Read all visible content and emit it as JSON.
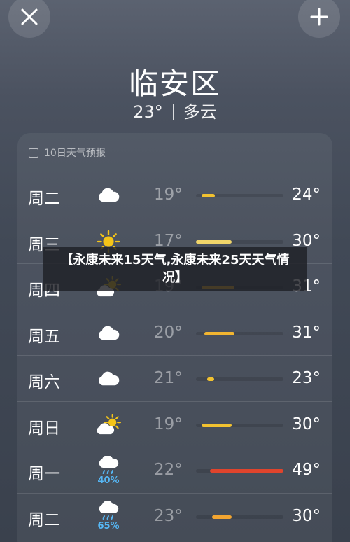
{
  "header": {
    "close_icon": "close-icon",
    "add_icon": "plus-icon",
    "city": "临安区",
    "temp": "23°",
    "condition": "多云"
  },
  "forecast": {
    "title": "10日天气预报",
    "range_min": 17,
    "range_max": 49,
    "days": [
      {
        "day": "周二",
        "icon": "cloud-icon",
        "precip": "",
        "low": "19°",
        "high": "24°",
        "low_val": 19,
        "high_val": 24,
        "color": "#f2c230"
      },
      {
        "day": "周三",
        "icon": "sun-icon",
        "precip": "",
        "low": "17°",
        "high": "30°",
        "low_val": 17,
        "high_val": 30,
        "color": "#f0d56a"
      },
      {
        "day": "周四",
        "icon": "partly-cloudy-icon",
        "precip": "",
        "low": "19°",
        "high": "31°",
        "low_val": 19,
        "high_val": 31,
        "color": "#f2b531"
      },
      {
        "day": "周五",
        "icon": "cloud-icon",
        "precip": "",
        "low": "20°",
        "high": "31°",
        "low_val": 20,
        "high_val": 31,
        "color": "#f2b531"
      },
      {
        "day": "周六",
        "icon": "cloud-icon",
        "precip": "",
        "low": "21°",
        "high": "23°",
        "low_val": 21,
        "high_val": 23,
        "color": "#f2c230"
      },
      {
        "day": "周日",
        "icon": "partly-cloudy-icon",
        "precip": "",
        "low": "19°",
        "high": "30°",
        "low_val": 19,
        "high_val": 30,
        "color": "#f2c230"
      },
      {
        "day": "周一",
        "icon": "rain-cloud-icon",
        "precip": "40%",
        "low": "22°",
        "high": "49°",
        "low_val": 22,
        "high_val": 49,
        "color": "#e0442c"
      },
      {
        "day": "周二",
        "icon": "rain-cloud-icon",
        "precip": "65%",
        "low": "23°",
        "high": "30°",
        "low_val": 23,
        "high_val": 30,
        "color": "#f2a531"
      }
    ]
  },
  "overlay": {
    "text": "【永康未来15天气,永康未来25天天气情况】"
  }
}
